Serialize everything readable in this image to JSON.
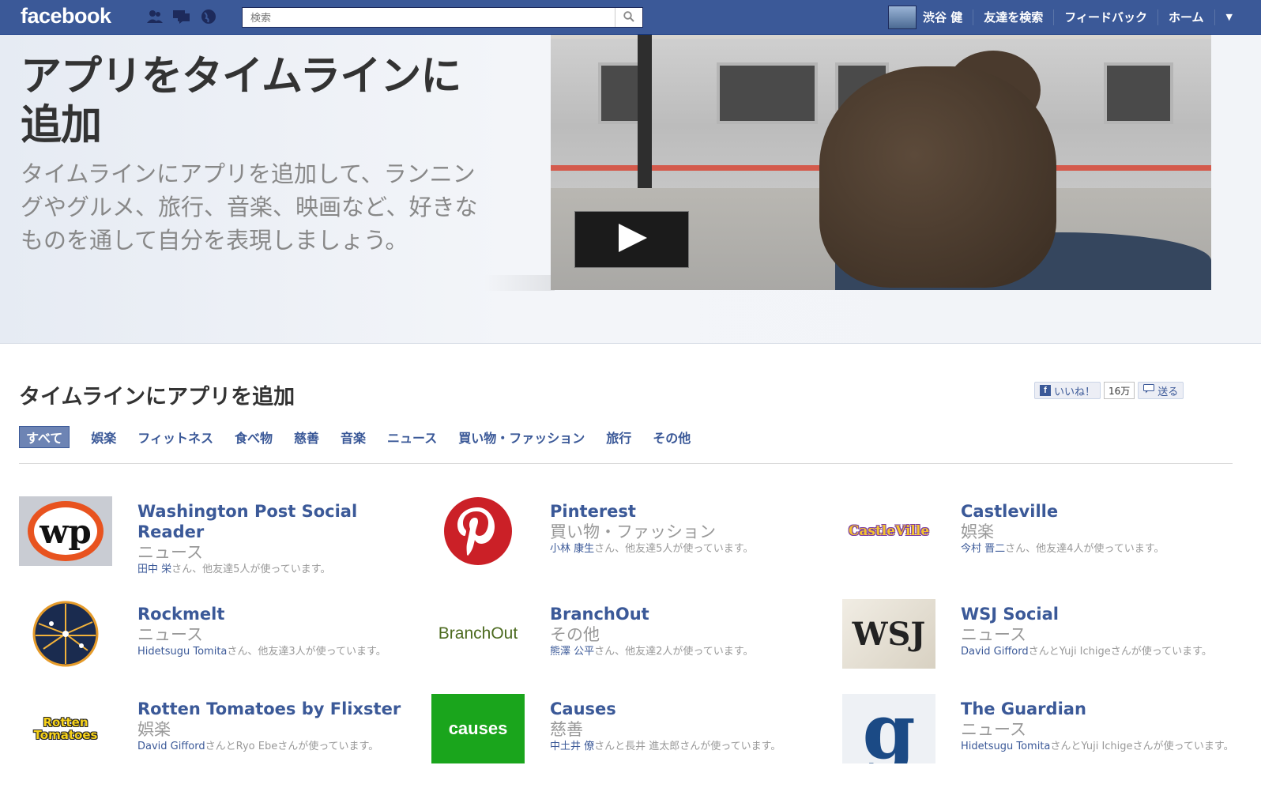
{
  "topbar": {
    "logo": "facebook",
    "search_placeholder": "検索",
    "user_name": "渋谷 健",
    "nav": [
      "友達を検索",
      "フィードバック",
      "ホーム"
    ]
  },
  "hero": {
    "title": "アプリをタイムラインに追加",
    "description": "タイムラインにアプリを追加して、ランニングやグルメ、旅行、音楽、映画など、好きなものを通して自分を表現しましょう。"
  },
  "section": {
    "title": "タイムラインにアプリを追加",
    "like_label": "いいね！",
    "like_count": "16万",
    "send_label": "送る"
  },
  "tabs": [
    "すべて",
    "娯楽",
    "フィットネス",
    "食べ物",
    "慈善",
    "音楽",
    "ニュース",
    "買い物・ファッション",
    "旅行",
    "その他"
  ],
  "apps": [
    {
      "name": "Washington Post Social Reader",
      "category": "ニュース",
      "friend": "田中 栄",
      "friends_suffix": "さん、他友達5人が使っています。",
      "icon": "wp-logo"
    },
    {
      "name": "Pinterest",
      "category": "買い物・ファッション",
      "friend": "小林 康生",
      "friends_suffix": "さん、他友達5人が使っています。",
      "icon": "pinterest-logo"
    },
    {
      "name": "Castleville",
      "category": "娯楽",
      "friend": "今村 晋二",
      "friends_suffix": "さん、他友達4人が使っています。",
      "icon": "castleville-logo",
      "logo_text": "CastleVille"
    },
    {
      "name": "Rockmelt",
      "category": "ニュース",
      "friend": "Hidetsugu Tomita",
      "friends_suffix": "さん、他友達3人が使っています。",
      "icon": "rockmelt-globe"
    },
    {
      "name": "BranchOut",
      "category": "その他",
      "friend": "熊澤 公平",
      "friends_suffix": "さん、他友達2人が使っています。",
      "icon": "branchout-logo",
      "logo_text": "BranchOut"
    },
    {
      "name": "WSJ Social",
      "category": "ニュース",
      "friend": "David Gifford",
      "friends_suffix": "さんとYuji Ichigeさんが使っています。",
      "icon": "wsj-logo",
      "logo_text": "WSJ"
    },
    {
      "name": "Rotten Tomatoes by Flixster",
      "category": "娯楽",
      "friend": "David Gifford",
      "friends_suffix": "さんとRyo Ebeさんが使っています。",
      "icon": "rotten-tomatoes-logo",
      "logo_text": "Rotten Tomatoes"
    },
    {
      "name": "Causes",
      "category": "慈善",
      "friend": "中土井 僚",
      "friends_suffix": "さんと長井 進太郎さんが使っています。",
      "icon": "causes-logo",
      "logo_text": "causes"
    },
    {
      "name": "The Guardian",
      "category": "ニュース",
      "friend": "Hidetsugu Tomita",
      "friends_suffix": "さんとYuji Ichigeさんが使っています。",
      "icon": "guardian-logo",
      "logo_text": "g"
    }
  ]
}
